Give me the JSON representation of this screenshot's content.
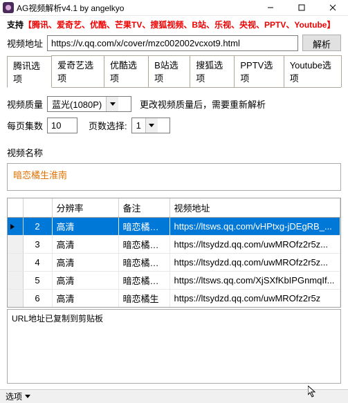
{
  "window": {
    "title": "AG视频解析v4.1 by angelkyo"
  },
  "support_line": {
    "prefix": "支持",
    "bracket_open": "【",
    "text": "腾讯、爱奇艺、优酷、芒果TV、搜狐视频、B站、乐视、央视、PPTV、Youtube",
    "bracket_close": "】"
  },
  "url_row": {
    "label": "视频地址",
    "value": "https://v.qq.com/x/cover/mzc002002vcxot9.html",
    "parse_btn": "解析"
  },
  "tabs": [
    "腾讯选项",
    "爱奇艺选项",
    "优酷选项",
    "B站选项",
    "搜狐选项",
    "PPTV选项",
    "Youtube选项"
  ],
  "quality_row": {
    "label": "视频质量",
    "selected": "蓝光(1080P)",
    "hint": "更改视频质量后，需要重新解析"
  },
  "per_page_row": {
    "label": "每页集数",
    "value": "10",
    "page_label": "页数选择:",
    "page_value": "1"
  },
  "name_row": {
    "label": "视频名称",
    "value": "暗恋橘生淮南"
  },
  "table": {
    "headers": [
      "",
      "",
      "分辨率",
      "备注",
      "视频地址"
    ],
    "rows": [
      {
        "n": "2",
        "res": "高清",
        "note": "暗恋橘生...",
        "url": "https://ltsws.qq.com/vHPtxg-jDEgRB_..."
      },
      {
        "n": "3",
        "res": "高清",
        "note": "暗恋橘生...",
        "url": "https://ltsydzd.qq.com/uwMROfz2r5z..."
      },
      {
        "n": "4",
        "res": "高清",
        "note": "暗恋橘生...",
        "url": "https://ltsydzd.qq.com/uwMROfz2r5z..."
      },
      {
        "n": "5",
        "res": "高清",
        "note": "暗恋橘生...",
        "url": "https://ltsws.qq.com/XjSXfKbIPGnmqIf..."
      },
      {
        "n": "6",
        "res": "高清",
        "note": "暗恋橘生",
        "url": "https://ltsydzd.qq.com/uwMROfz2r5z"
      }
    ]
  },
  "log": {
    "text": "URL地址已复制到剪贴板"
  },
  "footer": {
    "options": "选项"
  }
}
